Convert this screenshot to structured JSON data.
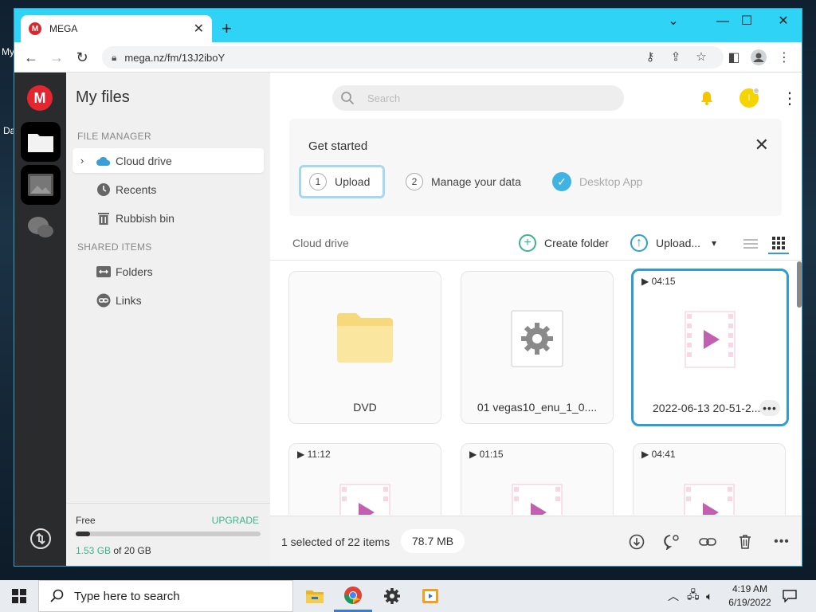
{
  "desktop": {
    "labels": [
      "My",
      "Da"
    ]
  },
  "browser": {
    "tab_title": "MEGA",
    "favicon_letter": "M",
    "url": "mega.nz/fm/13J2iboY"
  },
  "rail": {
    "logo_letter": "M"
  },
  "sidebar": {
    "title": "My files",
    "file_manager_heading": "FILE MANAGER",
    "items": [
      {
        "label": "Cloud drive",
        "icon": "cloud-icon"
      },
      {
        "label": "Recents",
        "icon": "clock-icon"
      },
      {
        "label": "Rubbish bin",
        "icon": "trash-icon"
      }
    ],
    "shared_heading": "SHARED ITEMS",
    "shared_items": [
      {
        "label": "Folders",
        "icon": "shared-folder-icon"
      },
      {
        "label": "Links",
        "icon": "link-icon"
      }
    ],
    "storage": {
      "free_label": "Free",
      "upgrade_label": "UPGRADE",
      "used": "1.53 GB",
      "of_total": " of 20 GB",
      "used_fraction": 0.0765
    }
  },
  "header": {
    "search_placeholder": "Search",
    "avatar_letter": "I",
    "accent_yellow": "#f5c400"
  },
  "get_started": {
    "title": "Get started",
    "steps": [
      {
        "num": "1",
        "label": "Upload",
        "state": "current"
      },
      {
        "num": "2",
        "label": "Manage your data",
        "state": "todo"
      },
      {
        "num": "",
        "label": "Desktop App",
        "state": "done"
      }
    ]
  },
  "toolbar": {
    "breadcrumb": "Cloud drive",
    "create_folder": "Create folder",
    "upload": "Upload..."
  },
  "files": [
    {
      "name": "DVD",
      "type": "folder",
      "duration": ""
    },
    {
      "name": "01 vegas10_enu_1_0....",
      "type": "exe",
      "duration": ""
    },
    {
      "name": "2022-06-13 20-51-2...",
      "type": "video",
      "duration": "04:15",
      "selected": true
    },
    {
      "name": "",
      "type": "video",
      "duration": "11:12"
    },
    {
      "name": "",
      "type": "video",
      "duration": "01:15"
    },
    {
      "name": "",
      "type": "video",
      "duration": "04:41"
    }
  ],
  "status": {
    "selection": "1 selected of 22 items",
    "size": "78.7 MB"
  },
  "taskbar": {
    "search_text": "Type here to search",
    "time": "4:19 AM",
    "date": "6/19/2022"
  },
  "colors": {
    "mega_red": "#e3262f",
    "tab_strip": "#2ed3f6",
    "accent_green": "#3cb38c",
    "accent_blue": "#2f9dd0"
  }
}
